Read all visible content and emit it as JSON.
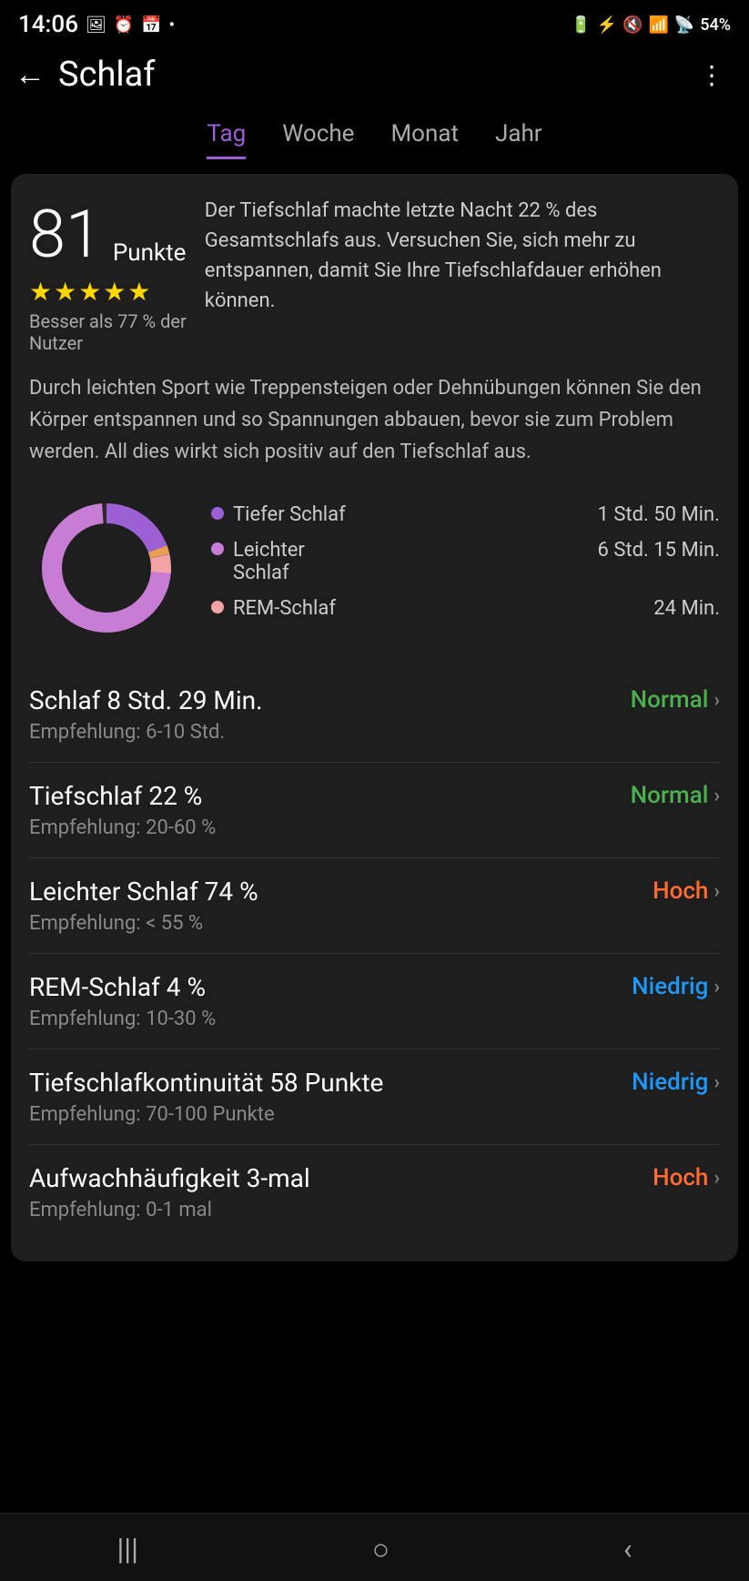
{
  "statusBar": {
    "time": "14:06",
    "icons": [
      "image",
      "alarm",
      "calendar",
      "dot",
      "battery-charging",
      "bluetooth",
      "mute",
      "wifi",
      "signal",
      "battery"
    ],
    "battery_percent": "54%"
  },
  "header": {
    "back_label": "←",
    "title": "Schlaf",
    "more_label": "⋮⋮"
  },
  "tabs": [
    {
      "label": "Tag",
      "active": true
    },
    {
      "label": "Woche",
      "active": false
    },
    {
      "label": "Monat",
      "active": false
    },
    {
      "label": "Jahr",
      "active": false
    }
  ],
  "score": {
    "number": "81",
    "label": "Punkte",
    "stars": "★★★★★",
    "sub": "Besser als 77 % der\nNutzer",
    "description": "Der Tiefschlaf machte letzte Nacht 22 % des Gesamtschlafs aus. Versuchen Sie, sich mehr zu entspannen, damit Sie Ihre Tiefschlafdauer erhöhen können."
  },
  "tip": "Durch leichten Sport wie Treppensteigen oder Dehnübungen können Sie den Körper entspannen und so Spannungen abbauen, bevor sie zum Problem werden. All dies wirkt sich positiv auf den Tiefschlaf aus.",
  "chart": {
    "legend": [
      {
        "label": "Tiefer Schlaf",
        "value": "1 Std. 50 Min.",
        "color": "#9c5fd4"
      },
      {
        "label": "Leichter\nSchlaf",
        "value": "6 Std. 15 Min.",
        "color": "#c87dd4"
      },
      {
        "label": "REM-Schlaf",
        "value": "24 Min.",
        "color": "#f4a4a4"
      }
    ],
    "segments": [
      {
        "label": "Tiefer Schlaf",
        "percent": 21.6,
        "color": "#9c5fd4"
      },
      {
        "label": "Leichter Schlaf",
        "percent": 73.8,
        "color": "#c87dd4"
      },
      {
        "label": "REM-Schlaf",
        "percent": 4.7,
        "color": "#f4a4a4"
      }
    ]
  },
  "metrics": [
    {
      "name": "Schlaf  8 Std. 29 Min.",
      "recommendation": "Empfehlung: 6-10 Std.",
      "status": "Normal",
      "status_color": "green"
    },
    {
      "name": "Tiefschlaf  22 %",
      "recommendation": "Empfehlung: 20-60 %",
      "status": "Normal",
      "status_color": "green"
    },
    {
      "name": "Leichter Schlaf  74 %",
      "recommendation": "Empfehlung: < 55 %",
      "status": "Hoch",
      "status_color": "orange"
    },
    {
      "name": "REM-Schlaf  4 %",
      "recommendation": "Empfehlung: 10-30 %",
      "status": "Niedrig",
      "status_color": "blue"
    },
    {
      "name": "Tiefschlafkontinuität  58 Punkte",
      "recommendation": "Empfehlung: 70-100 Punkte",
      "status": "Niedrig",
      "status_color": "blue"
    },
    {
      "name": "Aufwachhäufigkeit  3-mal",
      "recommendation": "Empfehlung: 0-1 mal",
      "status": "Hoch",
      "status_color": "orange"
    }
  ],
  "navBar": {
    "icons": [
      "|||",
      "○",
      "‹"
    ]
  }
}
